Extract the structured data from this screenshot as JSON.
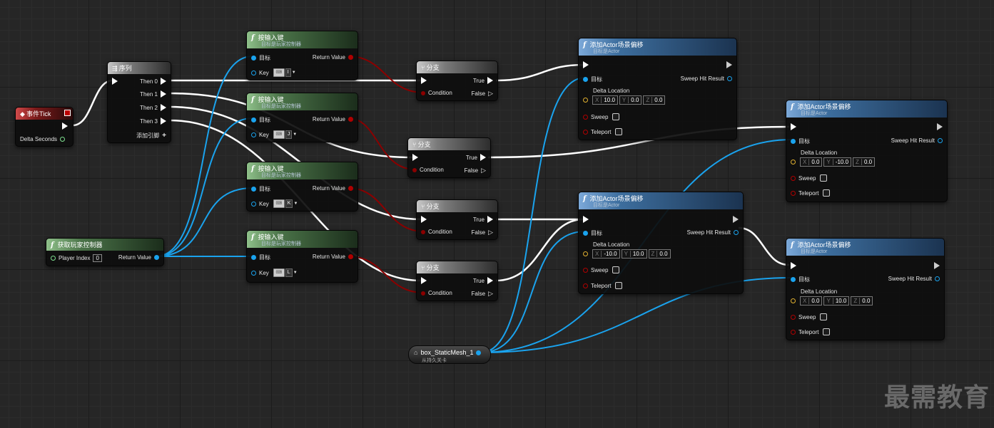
{
  "event_tick": {
    "title": "事件Tick",
    "pin_delta": "Delta Seconds"
  },
  "sequence": {
    "title": "序列",
    "then0": "Then 0",
    "then1": "Then 1",
    "then2": "Then 2",
    "then3": "Then 3",
    "add_pin": "添加引脚"
  },
  "get_controller": {
    "title": "获取玩家控制器",
    "player_index_label": "Player Index",
    "player_index_value": "0",
    "return_value": "Return Value"
  },
  "input_nodes": [
    {
      "title": "按输入键",
      "subtitle": "目标是玩家控制器",
      "target": "目标",
      "key": "Key",
      "key_value": "I",
      "return_value": "Return Value"
    },
    {
      "title": "按输入键",
      "subtitle": "目标是玩家控制器",
      "target": "目标",
      "key": "Key",
      "key_value": "J",
      "return_value": "Return Value"
    },
    {
      "title": "按输入键",
      "subtitle": "目标是玩家控制器",
      "target": "目标",
      "key": "Key",
      "key_value": "K",
      "return_value": "Return Value"
    },
    {
      "title": "按输入键",
      "subtitle": "目标是玩家控制器",
      "target": "目标",
      "key": "Key",
      "key_value": "L",
      "return_value": "Return Value"
    }
  ],
  "branches": [
    {
      "title": "分支",
      "true_label": "True",
      "false_label": "False",
      "condition": "Condition"
    },
    {
      "title": "分支",
      "true_label": "True",
      "false_label": "False",
      "condition": "Condition"
    },
    {
      "title": "分支",
      "true_label": "True",
      "false_label": "False",
      "condition": "Condition"
    },
    {
      "title": "分支",
      "true_label": "True",
      "false_label": "False",
      "condition": "Condition"
    }
  ],
  "offset_nodes": [
    {
      "title": "添加Actor场景偏移",
      "subtitle": "目标是Actor",
      "target": "目标",
      "sweep_hit": "Sweep Hit Result",
      "delta_location": "Delta Location",
      "x_label": "X",
      "x": "10.0",
      "y_label": "Y",
      "y": "0.0",
      "z_label": "Z",
      "z": "0.0",
      "sweep": "Sweep",
      "teleport": "Teleport"
    },
    {
      "title": "添加Actor场景偏移",
      "subtitle": "目标是Actor",
      "target": "目标",
      "sweep_hit": "Sweep Hit Result",
      "delta_location": "Delta Location",
      "x_label": "X",
      "x": "0.0",
      "y_label": "Y",
      "y": "-10.0",
      "z_label": "Z",
      "z": "0.0",
      "sweep": "Sweep",
      "teleport": "Teleport"
    },
    {
      "title": "添加Actor场景偏移",
      "subtitle": "目标是Actor",
      "target": "目标",
      "sweep_hit": "Sweep Hit Result",
      "delta_location": "Delta Location",
      "x_label": "X",
      "x": "-10.0",
      "y_label": "Y",
      "y": "10.0",
      "z_label": "Z",
      "z": "0.0",
      "sweep": "Sweep",
      "teleport": "Teleport"
    },
    {
      "title": "添加Actor场景偏移",
      "subtitle": "目标是Actor",
      "target": "目标",
      "sweep_hit": "Sweep Hit Result",
      "delta_location": "Delta Location",
      "x_label": "X",
      "x": "0.0",
      "y_label": "Y",
      "y": "10.0",
      "z_label": "Z",
      "z": "0.0",
      "sweep": "Sweep",
      "teleport": "Teleport"
    }
  ],
  "mesh_var": {
    "name": "box_StaticMesh_1",
    "subtitle": "从持久关卡"
  },
  "watermark": "最需教育",
  "colors": {
    "exec_wire": "#ffffff",
    "object_wire": "#1aa3ee",
    "bool_wire": "#8b0000",
    "function_header": "#3d6e9e",
    "input_header": "#4a7348",
    "event_header": "#7a1a1a"
  }
}
